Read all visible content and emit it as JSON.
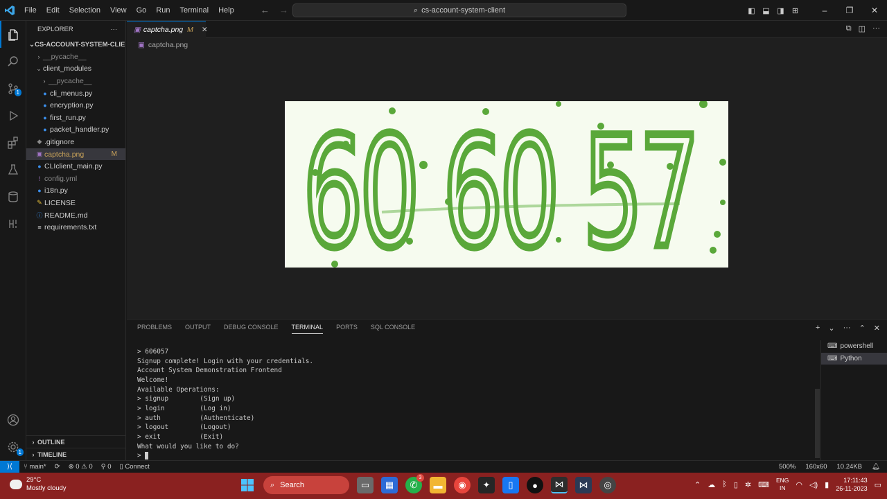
{
  "titlebar": {
    "menu": [
      "File",
      "Edit",
      "Selection",
      "View",
      "Go",
      "Run",
      "Terminal",
      "Help"
    ],
    "search_text": "cs-account-system-client"
  },
  "activity_bar": {
    "source_control_badge": "1"
  },
  "sidebar": {
    "header": "EXPLORER",
    "project": "CS-ACCOUNT-SYSTEM-CLIENT",
    "tree": [
      {
        "label": "__pycache__",
        "indent": 1,
        "type": "folder",
        "collapsed": true,
        "dim": true
      },
      {
        "label": "client_modules",
        "indent": 1,
        "type": "folder",
        "collapsed": false
      },
      {
        "label": "__pycache__",
        "indent": 2,
        "type": "folder",
        "collapsed": true,
        "dim": true
      },
      {
        "label": "cli_menus.py",
        "indent": 2,
        "type": "py"
      },
      {
        "label": "encryption.py",
        "indent": 2,
        "type": "py"
      },
      {
        "label": "first_run.py",
        "indent": 2,
        "type": "py"
      },
      {
        "label": "packet_handler.py",
        "indent": 2,
        "type": "py"
      },
      {
        "label": ".gitignore",
        "indent": 1,
        "type": "git"
      },
      {
        "label": "captcha.png",
        "indent": 1,
        "type": "png",
        "selected": true,
        "flag": "M"
      },
      {
        "label": "CLIclient_main.py",
        "indent": 1,
        "type": "py"
      },
      {
        "label": "config.yml",
        "indent": 1,
        "type": "yml",
        "dim": true
      },
      {
        "label": "i18n.py",
        "indent": 1,
        "type": "py"
      },
      {
        "label": "LICENSE",
        "indent": 1,
        "type": "lic"
      },
      {
        "label": "README.md",
        "indent": 1,
        "type": "md"
      },
      {
        "label": "requirements.txt",
        "indent": 1,
        "type": "txt"
      }
    ],
    "outline": "OUTLINE",
    "timeline": "TIMELINE"
  },
  "editor": {
    "tab_label": "captcha.png",
    "tab_flag": "M",
    "breadcrumb": "captcha.png",
    "captcha_text": "60 60 57"
  },
  "panel": {
    "tabs": [
      "PROBLEMS",
      "OUTPUT",
      "DEBUG CONSOLE",
      "TERMINAL",
      "PORTS",
      "SQL CONSOLE"
    ],
    "active_tab": "TERMINAL",
    "terminal_lines": [
      "> 606057",
      "Signup complete! Login with your credentials.",
      "Account System Demonstration Frontend",
      "Welcome!",
      "Available Operations:",
      "> signup        (Sign up)",
      "> login         (Log in)",
      "> auth          (Authenticate)",
      "> logout        (Logout)",
      "> exit          (Exit)",
      "What would you like to do?",
      "> "
    ],
    "terminals": [
      "powershell",
      "Python"
    ]
  },
  "statusbar": {
    "branch": "main*",
    "errors": "0",
    "warnings": "0",
    "ports": "0",
    "connect": "Connect",
    "zoom": "500%",
    "dimensions": "160x60",
    "size": "10.24KB"
  },
  "taskbar": {
    "temp": "29°C",
    "weather": "Mostly cloudy",
    "search": "Search",
    "whatsapp_badge": "3",
    "lang1": "ENG",
    "lang2": "IN",
    "time": "17:11:43",
    "date": "26-11-2023"
  },
  "colors": {
    "accent": "#0078d4",
    "captcha_green": "#5aa83a",
    "taskbar": "#8a2120"
  }
}
